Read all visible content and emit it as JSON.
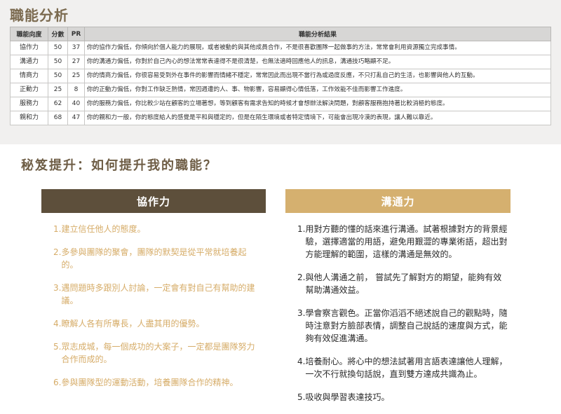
{
  "analysis": {
    "title": "職能分析",
    "headers": [
      "職能向度",
      "分數",
      "PR",
      "職能分析結果"
    ],
    "rows": [
      {
        "name": "協作力",
        "score": "50",
        "pr": "37",
        "result": "你的協作力偏低，你傾向於個人能力的展現，或者被動的與其他成員合作，不是很喜歡團隊一起做事的方法，常常會利用資源獨立完成事情。"
      },
      {
        "name": "溝通力",
        "score": "50",
        "pr": "27",
        "result": "你的溝通力偏低，你對於自己內心的想法常常表達得不是很清楚，也無法適時回應他人的訊息，溝通技巧略顯不足。"
      },
      {
        "name": "情商力",
        "score": "50",
        "pr": "25",
        "result": "你的情商力偏低，你很容易受到外在事件的影響而情緒不穩定，常常因此而出現不當行為或過度反應，不只打亂自己的生活，也影響與他人的互動。"
      },
      {
        "name": "正動力",
        "score": "25",
        "pr": "8",
        "result": "你的正動力偏低，你對工作缺乏熱情，常因週遭的人、事、物影響，容易顯得心情低落，工作效能不佳而影響工作進度。"
      },
      {
        "name": "服務力",
        "score": "62",
        "pr": "40",
        "result": "你的服務力偏低，你比較少站在顧客的立場著想，等到顧客有需求告知的時候才會想辦法解決問題，對顧客服務抱持著比較消極的態度。"
      },
      {
        "name": "親和力",
        "score": "68",
        "pr": "47",
        "result": "你的親和力一般，你的態度給人的感覺是平和與穩定的，但是在陌生環境或者特定情境下，可能會出現冷漠的表現，讓人難以靠近。"
      }
    ]
  },
  "tips": {
    "title": "秘笈提升：如何提升我的職能？",
    "left": {
      "heading": "協作力",
      "items": [
        {
          "num": "1.",
          "text": "建立信任他人的態度。"
        },
        {
          "num": "2.",
          "text": "多參與團隊的聚會，團隊的默契是從平常就培養起的。"
        },
        {
          "num": "3.",
          "text": "遇問題時多跟別人討論，一定會有對自己有幫助的建議。"
        },
        {
          "num": "4.",
          "text": "瞭解人各有所專長，人盡其用的優勢。"
        },
        {
          "num": "5.",
          "text": "眾志成城，每一個成功的大案子，一定都是團隊努力合作而成的。"
        },
        {
          "num": "6.",
          "text": "參與團隊型的運動活動，培養團隊合作的精神。"
        }
      ]
    },
    "right": {
      "heading": "溝通力",
      "items": [
        {
          "num": "1.",
          "text": "用對方聽的懂的話來進行溝通。試著根據對方的背景經驗，選擇適當的用語，避免用艱澀的專業術語，超出對方能理解的範圍，這樣的溝通是無效的。"
        },
        {
          "num": "2.",
          "text": "與他人溝通之前， 嘗試先了解對方的期望，能夠有效幫助溝通效益。"
        },
        {
          "num": "3.",
          "text": "學會察言觀色。正當你滔滔不絕述說自己的觀點時，隨時注意對方臉部表情，調整自己說話的速度與方式，能夠有效促進溝通。"
        },
        {
          "num": "4.",
          "text": "培養耐心。將心中的想法試著用言語表達讓他人理解，一次不行就換句話說，直到雙方達成共識為止。"
        },
        {
          "num": "5.",
          "text": "吸收與學習表達技巧。"
        }
      ]
    }
  }
}
